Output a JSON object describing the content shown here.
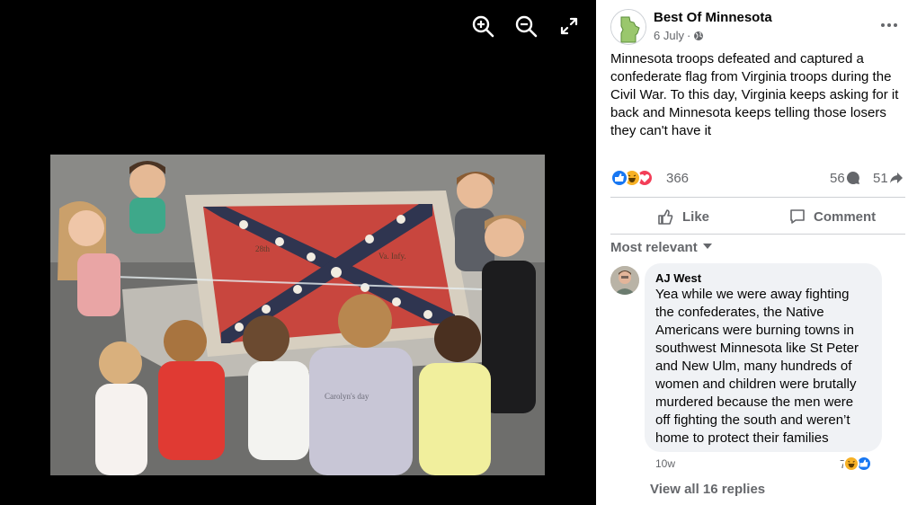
{
  "viewer": {
    "controls": [
      {
        "name": "zoom-in-icon",
        "label": "Zoom in"
      },
      {
        "name": "zoom-out-icon",
        "label": "Zoom out"
      },
      {
        "name": "fullscreen-icon",
        "label": "Full screen"
      }
    ],
    "photo": {
      "flag_label_left": "28th",
      "flag_label_right": "Va. Infy.",
      "shirt_text": "Carolyn's day"
    }
  },
  "post": {
    "page_name": "Best Of Minnesota",
    "date": "6 July",
    "separator": "·",
    "privacy_icon": "globe-icon",
    "more_icon": "more-horizontal-icon",
    "text": "Minnesota troops defeated and captured a confederate flag from Virginia troops during the Civil War. To this day, Virginia keeps asking for it back and Minnesota keeps telling those losers they can't have it",
    "reactions": {
      "icons": [
        "like-reaction-icon",
        "haha-reaction-icon",
        "love-reaction-icon"
      ],
      "count": "366",
      "comments": "56",
      "shares": "51"
    },
    "actions": {
      "like_label": "Like",
      "comment_label": "Comment"
    }
  },
  "comments": {
    "sort_label": "Most relevant",
    "items": [
      {
        "author": "AJ West",
        "text": "Yea while we were away fighting the confederates, the Native Americans were burning towns in southwest Minnesota like St Peter and New Ulm, many hundreds of women and children were brutally murdered because the men were off fighting the south and weren’t home to protect their families",
        "time": "10w",
        "reaction_count": "7",
        "reaction_icons": [
          "haha-reaction-icon",
          "like-reaction-icon"
        ]
      }
    ],
    "view_replies_label": "View all 16 replies"
  },
  "colors": {
    "like_blue": "#1877f2",
    "love_red": "#f33e58",
    "haha_yellow": "#f7b125",
    "secondary_text": "#65676b",
    "divider": "#ced0d4",
    "comment_bubble": "#f0f2f5"
  }
}
